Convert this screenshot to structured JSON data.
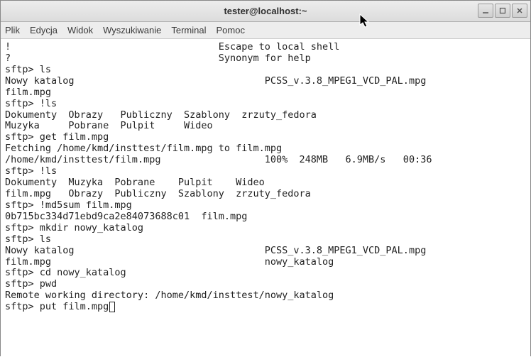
{
  "window": {
    "title": "tester@localhost:~"
  },
  "menubar": {
    "items": [
      "Plik",
      "Edycja",
      "Widok",
      "Wyszukiwanie",
      "Terminal",
      "Pomoc"
    ]
  },
  "terminal": {
    "lines": [
      "!                                    Escape to local shell",
      "?                                    Synonym for help",
      "sftp> ls",
      "Nowy katalog                                 PCSS_v.3.8_MPEG1_VCD_PAL.mpg",
      "film.mpg",
      "sftp> !ls",
      "Dokumenty  Obrazy   Publiczny  Szablony  zrzuty_fedora",
      "Muzyka     Pobrane  Pulpit     Wideo",
      "sftp> get film.mpg",
      "Fetching /home/kmd/insttest/film.mpg to film.mpg",
      "/home/kmd/insttest/film.mpg                  100%  248MB   6.9MB/s   00:36",
      "sftp> !ls",
      "Dokumenty  Muzyka  Pobrane    Pulpit    Wideo",
      "film.mpg   Obrazy  Publiczny  Szablony  zrzuty_fedora",
      "sftp> !md5sum film.mpg",
      "0b715bc334d71ebd9ca2e84073688c01  film.mpg",
      "sftp> mkdir nowy_katalog",
      "sftp> ls",
      "Nowy katalog                                 PCSS_v.3.8_MPEG1_VCD_PAL.mpg",
      "film.mpg                                     nowy_katalog",
      "sftp> cd nowy_katalog",
      "sftp> pwd",
      "Remote working directory: /home/kmd/insttest/nowy_katalog",
      "sftp> put film.mpg"
    ]
  }
}
